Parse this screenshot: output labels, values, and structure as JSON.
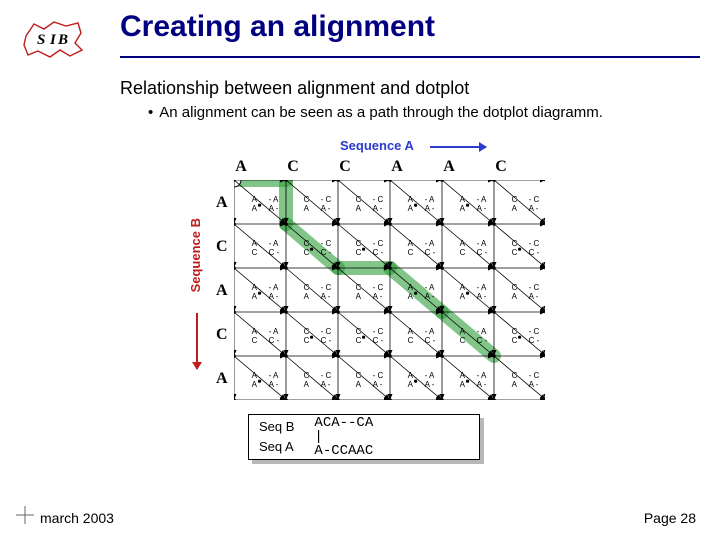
{
  "title": "Creating an alignment",
  "subtitle": "Relationship between alignment and dotplot",
  "bullet": "An alignment can be seen as a path through the dotplot diagramm.",
  "seqA_label": "Sequence A",
  "seqB_label": "Sequence B",
  "col_headers": [
    "A",
    "C",
    "C",
    "A",
    "A",
    "C"
  ],
  "row_headers": [
    "A",
    "C",
    "A",
    "C",
    "A"
  ],
  "alignment": {
    "label_b": "Seq B",
    "label_a": "Seq A",
    "seq_b": "ACA--CA",
    "match": "|",
    "seq_a": "A-CCAAC"
  },
  "footer_date": "march 2003",
  "footer_page": "Page 28",
  "colors": {
    "title": "#000080",
    "seqA": "#2a3cd0",
    "seqB": "#c11b1b",
    "path": "#2fa03a"
  },
  "chart_data": {
    "type": "table",
    "description": "Dotplot matrix of Sequence A (columns) vs Sequence B (rows). Each cell shows the two aligned residues and a dot when they match. A green path shows the chosen alignment.",
    "seq_a": [
      "A",
      "C",
      "C",
      "A",
      "A",
      "C"
    ],
    "seq_b": [
      "A",
      "C",
      "A",
      "C",
      "A"
    ],
    "matches": [
      [
        true,
        false,
        false,
        true,
        true,
        false
      ],
      [
        false,
        true,
        true,
        false,
        false,
        true
      ],
      [
        true,
        false,
        false,
        true,
        true,
        false
      ],
      [
        false,
        true,
        true,
        false,
        false,
        true
      ],
      [
        true,
        false,
        false,
        true,
        true,
        false
      ]
    ],
    "alignment_path": [
      [
        0,
        0
      ],
      [
        0,
        1
      ],
      [
        1,
        1
      ],
      [
        2,
        2
      ],
      [
        2,
        3
      ],
      [
        3,
        4
      ],
      [
        4,
        5
      ]
    ]
  }
}
